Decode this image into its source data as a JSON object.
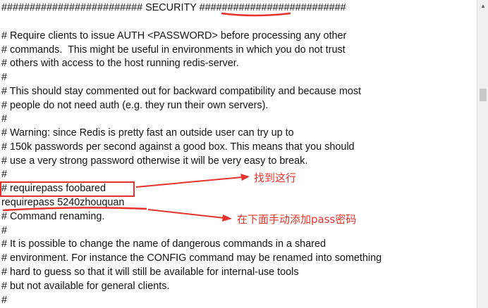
{
  "editor": {
    "lines": [
      "######################### SECURITY ##########################",
      "",
      "# Require clients to issue AUTH <PASSWORD> before processing any other",
      "# commands.  This might be useful in environments in which you do not trust",
      "# others with access to the host running redis-server.",
      "#",
      "# This should stay commented out for backward compatibility and because most",
      "# people do not need auth (e.g. they run their own servers).",
      "#",
      "# Warning: since Redis is pretty fast an outside user can try up to",
      "# 150k passwords per second against a good box. This means that you should",
      "# use a very strong password otherwise it will be very easy to break.",
      "#",
      "# requirepass foobared",
      "requirepass 5240zhouquan",
      "# Command renaming.",
      "#",
      "# It is possible to change the name of dangerous commands in a shared",
      "# environment. For instance the CONFIG command may be renamed into something",
      "# hard to guess so that it will still be available for internal-use tools",
      "# but not available for general clients.",
      "#"
    ]
  },
  "annotations": {
    "find_line_note": "找到这行",
    "add_pass_note": "在下面手动添加pass密码"
  },
  "colors": {
    "annotation_red": "#e8332c",
    "text": "#111111"
  },
  "icons": {
    "scroll_up": "scroll-up-arrow-icon"
  }
}
